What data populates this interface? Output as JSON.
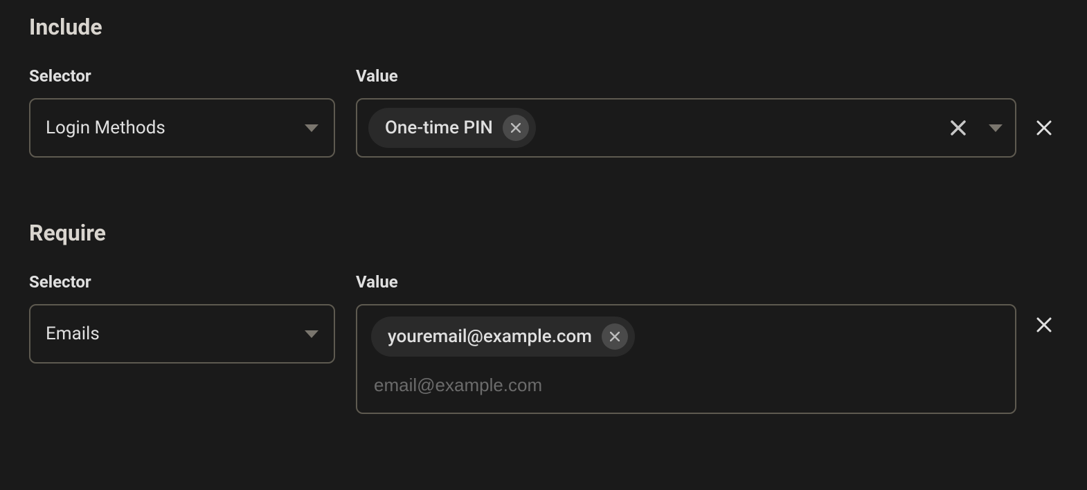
{
  "include": {
    "title": "Include",
    "selector_label": "Selector",
    "value_label": "Value",
    "selector_value": "Login Methods",
    "chips": [
      "One-time PIN"
    ]
  },
  "require": {
    "title": "Require",
    "selector_label": "Selector",
    "value_label": "Value",
    "selector_value": "Emails",
    "chips": [
      "youremail@example.com"
    ],
    "input_placeholder": "email@example.com"
  }
}
